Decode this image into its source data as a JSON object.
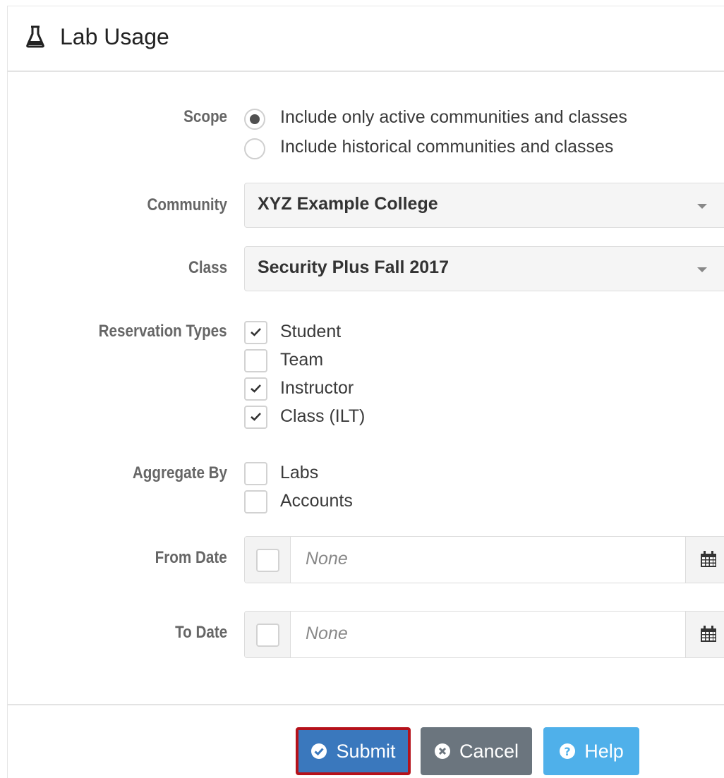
{
  "header": {
    "title": "Lab Usage",
    "icon": "flask-icon"
  },
  "scope": {
    "label": "Scope",
    "options": [
      {
        "label": "Include only active communities and classes",
        "selected": true
      },
      {
        "label": "Include historical communities and classes",
        "selected": false
      }
    ]
  },
  "community": {
    "label": "Community",
    "value": "XYZ Example College"
  },
  "class": {
    "label": "Class",
    "value": "Security Plus Fall 2017"
  },
  "reservation_types": {
    "label": "Reservation Types",
    "items": [
      {
        "label": "Student",
        "checked": true
      },
      {
        "label": "Team",
        "checked": false
      },
      {
        "label": "Instructor",
        "checked": true
      },
      {
        "label": "Class (ILT)",
        "checked": true
      }
    ]
  },
  "aggregate_by": {
    "label": "Aggregate By",
    "items": [
      {
        "label": "Labs",
        "checked": false
      },
      {
        "label": "Accounts",
        "checked": false
      }
    ]
  },
  "from_date": {
    "label": "From Date",
    "placeholder": "None",
    "enabled": false
  },
  "to_date": {
    "label": "To Date",
    "placeholder": "None",
    "enabled": false
  },
  "buttons": {
    "submit": "Submit",
    "cancel": "Cancel",
    "help": "Help"
  },
  "colors": {
    "submit": "#3a78bd",
    "submit_outline": "#b5121b",
    "cancel": "#6b757e",
    "help": "#4fb0ea"
  }
}
